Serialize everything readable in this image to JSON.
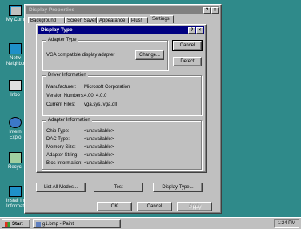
{
  "desktop": {
    "icons": [
      {
        "label": "My Com",
        "icon": "my-computer-icon"
      },
      {
        "label": "Netw\nNeighbo",
        "icon": "network-neighborhood-icon"
      },
      {
        "label": "Inbo",
        "icon": "inbox-icon"
      },
      {
        "label": "Intern\nExplo",
        "icon": "internet-explorer-icon"
      },
      {
        "label": "Recycl",
        "icon": "recycle-bin-icon"
      },
      {
        "label": "Install In\nInformat",
        "icon": "install-info-icon"
      }
    ]
  },
  "display_properties": {
    "title": "Display Properties",
    "help_glyph": "?",
    "close_glyph": "×",
    "tabs": [
      "Background",
      "Screen Saver",
      "Appearance",
      "Plus!",
      "Settings"
    ]
  },
  "display_type": {
    "title": "Display Type",
    "help_glyph": "?",
    "close_glyph": "×",
    "adapter_type": {
      "label": "Adapter Type",
      "value": "VGA compatible display adapter",
      "change_button": "Change..."
    },
    "cancel_button": "Cancel",
    "detect_button": "Detect",
    "driver_info": {
      "label": "Driver Information",
      "manufacturer_label": "Manufacturer:",
      "manufacturer_value": "Microsoft Corporation",
      "version_label": "Version Numbers:",
      "version_value": "4.00, 4.0.0",
      "files_label": "Current Files:",
      "files_value": "vga.sys, vga.dll"
    },
    "adapter_info": {
      "label": "Adapter Information",
      "rows": [
        {
          "label": "Chip Type:",
          "value": "<unavailable>"
        },
        {
          "label": "DAC Type:",
          "value": "<unavailable>"
        },
        {
          "label": "Memory Size:",
          "value": "<unavailable>"
        },
        {
          "label": "Adapter String:",
          "value": "<unavailable>"
        },
        {
          "label": "Bios Information:",
          "value": "<unavailable>"
        }
      ]
    }
  },
  "settings_buttons": {
    "list_all_modes": "List All Modes...",
    "test": "Test",
    "display_type": "Display Type..."
  },
  "footer_buttons": {
    "ok": "OK",
    "cancel": "Cancel",
    "apply": "Apply"
  },
  "taskbar": {
    "start": "Start",
    "task": "g1.bmp - Paint",
    "clock": "1:24 PM"
  }
}
